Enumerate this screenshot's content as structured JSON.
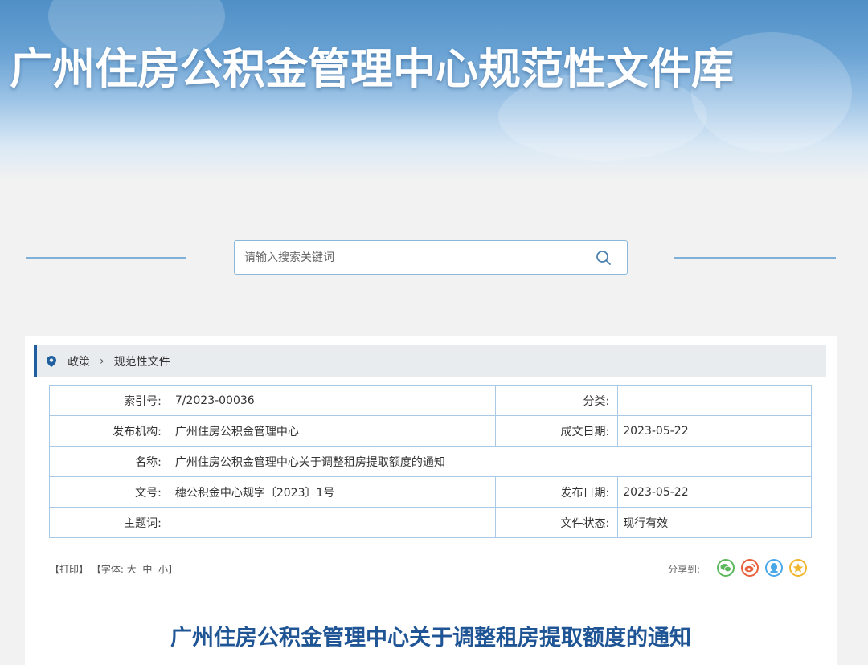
{
  "header": {
    "title": "广州住房公积金管理中心规范性文件库"
  },
  "search": {
    "placeholder": "请输入搜索关键词"
  },
  "breadcrumb": {
    "items": [
      "政策",
      "规范性文件"
    ]
  },
  "meta_table": {
    "rows": [
      {
        "label1": "索引号:",
        "value1": "7/2023-00036",
        "label2": "分类:",
        "value2": ""
      },
      {
        "label1": "发布机构:",
        "value1": "广州住房公积金管理中心",
        "label2": "成文日期:",
        "value2": "2023-05-22"
      },
      {
        "label1": "名称:",
        "value1": "广州住房公积金管理中心关于调整租房提取额度的通知"
      },
      {
        "label1": "文号:",
        "value1": "穗公积金中心规字〔2023〕1号",
        "label2": "发布日期:",
        "value2": "2023-05-22"
      },
      {
        "label1": "主题词:",
        "value1": "",
        "label2": "文件状态:",
        "value2": "现行有效"
      }
    ]
  },
  "tools": {
    "print": "【打印】",
    "font_prefix": "【字体:",
    "font_large": "大",
    "font_medium": "中",
    "font_small": "小",
    "font_suffix": "】"
  },
  "share": {
    "label": "分享到:",
    "icons": [
      "wechat-icon",
      "weibo-icon",
      "qq-icon",
      "qzone-icon"
    ],
    "colors": [
      "#5cb85c",
      "#e8603c",
      "#4aa7e8",
      "#f0b72e"
    ]
  },
  "document": {
    "title": "广州住房公积金管理中心关于调整租房提取额度的通知"
  }
}
